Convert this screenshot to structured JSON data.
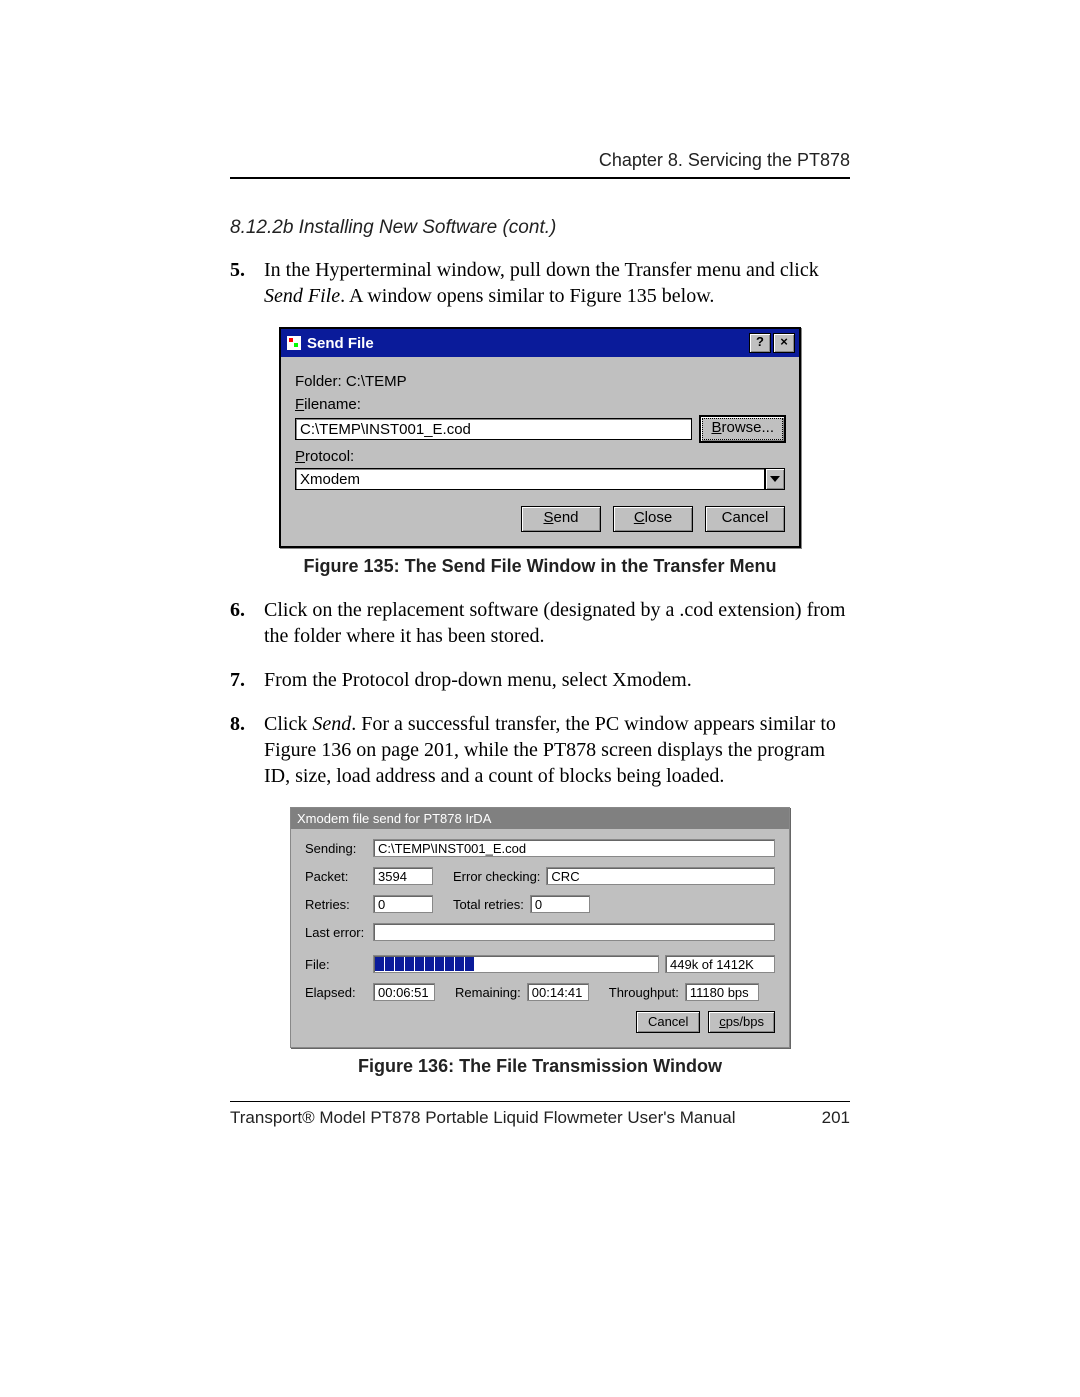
{
  "header": {
    "chapter": "Chapter 8. Servicing the PT878"
  },
  "section_title": "8.12.2b Installing New Software (cont.)",
  "steps_a": {
    "n5": "5.",
    "t5_pre": "In the Hyperterminal window, pull down the Transfer menu and click ",
    "t5_em": "Send File",
    "t5_post": ". A window opens similar to Figure 135 below."
  },
  "fig135": {
    "caption": "Figure 135: The Send File Window in the Transfer Menu",
    "title": "Send File",
    "help_btn": "?",
    "close_btn": "×",
    "folder_label": "Folder: C:\\TEMP",
    "filename_label_pre": "",
    "filename_label_u": "F",
    "filename_label_post": "ilename:",
    "filename_value": "C:\\TEMP\\INST001_E.cod",
    "browse_u": "B",
    "browse_post": "rowse...",
    "protocol_u": "P",
    "protocol_post": "rotocol:",
    "protocol_value": "Xmodem",
    "send_u": "S",
    "send_post": "end",
    "close_btn_u": "C",
    "close_btn_post": "lose",
    "cancel": "Cancel"
  },
  "steps_b": {
    "n6": "6.",
    "t6": "Click on the replacement software (designated by a .cod extension) from the folder where it has been stored.",
    "n7": "7.",
    "t7": "From the Protocol drop-down menu, select Xmodem.",
    "n8": "8.",
    "t8_pre": "Click ",
    "t8_em": "Send",
    "t8_post": ". For a successful transfer, the PC window appears similar to Figure 136 on page 201, while the PT878 screen displays the program ID, size, load address and a count of blocks being loaded."
  },
  "fig136": {
    "caption": "Figure 136: The File Transmission Window",
    "title": "Xmodem file send for PT878 IrDA",
    "lbl_sending": "Sending:",
    "val_sending": "C:\\TEMP\\INST001_E.cod",
    "lbl_packet": "Packet:",
    "val_packet": "3594",
    "lbl_errchk": "Error checking:",
    "val_errchk": "CRC",
    "lbl_retries": "Retries:",
    "val_retries": "0",
    "lbl_totretries": "Total retries:",
    "val_totretries": "0",
    "lbl_lasterror": "Last error:",
    "val_lasterror": "",
    "lbl_file": "File:",
    "val_file_right": "449k of 1412K",
    "lbl_elapsed": "Elapsed:",
    "val_elapsed": "00:06:51",
    "lbl_remaining": "Remaining:",
    "val_remaining": "00:14:41",
    "lbl_throughput": "Throughput:",
    "val_throughput": "11180 bps",
    "cancel": "Cancel",
    "cpsbps_u": "c",
    "cpsbps_post": "ps/bps"
  },
  "footer": {
    "left": "Transport® Model PT878 Portable Liquid Flowmeter User's Manual",
    "page": "201"
  }
}
